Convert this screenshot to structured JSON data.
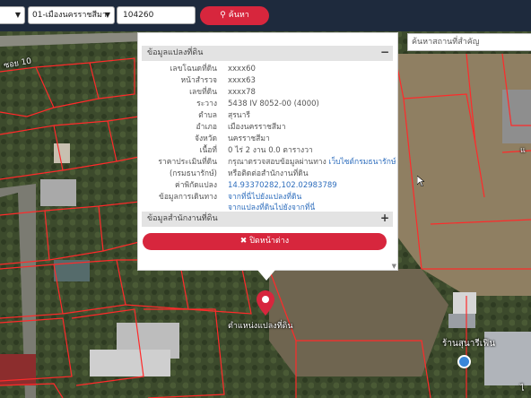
{
  "toolbar": {
    "province_select": "",
    "district_select": "01-เมืองนครราชสีมา",
    "code_input_value": "104260",
    "search_button_label": "ค้นหา"
  },
  "place_search": {
    "placeholder": "ค้นหาสถานที่สำคัญ"
  },
  "panel": {
    "section1_title": "ข้อมูลแปลงที่ดิน",
    "section1_toggle": "−",
    "rows": [
      {
        "label": "เลขโฉนดที่ดิน",
        "value": "xxxx60"
      },
      {
        "label": "หน้าสำรวจ",
        "value": "xxxx63"
      },
      {
        "label": "เลขที่ดิน",
        "value": "xxxx78"
      },
      {
        "label": "ระวาง",
        "value": "5438 IV 8052-00 (4000)"
      },
      {
        "label": "ตำบล",
        "value": "สุรนารี"
      },
      {
        "label": "อำเภอ",
        "value": "เมืองนครราชสีมา"
      },
      {
        "label": "จังหวัด",
        "value": "นครราชสีมา"
      },
      {
        "label": "เนื้อที่",
        "value": "0 ไร่ 2 งาน 0.0 ตารางวา"
      }
    ],
    "price_label": "ราคาประเมินที่ดิน",
    "price_value": "กรุณาตรวจสอบข้อมูลผ่านทาง",
    "price_link": "เว็บไซต์กรมธนารักษ์",
    "treasury_label": "(กรมธนารักษ์)",
    "treasury_value": "หรือติดต่อสำนักงานที่ดิน",
    "coord_label": "ค่าพิกัดแปลง",
    "coord_value": "14.93370282,102.02983789",
    "travel_label": "ข้อมูลการเดินทาง",
    "travel_link1": "จากที่นี่ไปยังแปลงที่ดิน",
    "travel_link2": "จากแปลงที่ดินไปยังจากที่นี่",
    "section2_title": "ข้อมูลสำนักงานที่ดิน",
    "section2_toggle": "+",
    "close_label": "ปิดหน้าต่าง"
  },
  "map": {
    "road_label": "ซอย 10",
    "marker_label": "ตำแหน่งแปลงที่ดิน",
    "shop_label": "ร้านสุนารีเฟิน",
    "edge_label_top": "แ",
    "edge_label_bottom": "ไ"
  },
  "icons": {
    "search": "search-icon",
    "close": "close-icon",
    "pin": "map-pin-icon",
    "shop": "shop-icon"
  },
  "colors": {
    "topbar": "#1e2a3d",
    "accent_red": "#d7263d",
    "link_blue": "#2f6ebd",
    "parcel_line": "#ff2a2a"
  }
}
